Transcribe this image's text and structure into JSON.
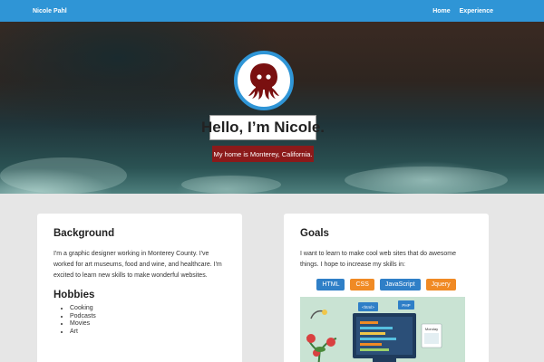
{
  "nav": {
    "brand": "Nicole Pahl",
    "links": [
      "Home",
      "Experience"
    ]
  },
  "hero": {
    "greeting": "Hello, I’m Nicole.",
    "subtitle": "My home is Monterey, California."
  },
  "background_card": {
    "title": "Background",
    "text": "I'm a graphic designer working in Monterey County. I've worked for art museums, food and wine, and healthcare. I'm excited to learn new skills to make wonderful websites.",
    "hobbies_title": "Hobbies",
    "hobbies": [
      "Cooking",
      "Podcasts",
      "Movies",
      "Art"
    ]
  },
  "goals_card": {
    "title": "Goals",
    "text": "I want to learn to make cool web sites that do awesome things. I hope to increase my skills in:",
    "skills": [
      "HTML",
      "CSS",
      "JavaScript",
      "Jquery"
    ],
    "illustration_labels": [
      "<html>",
      "PHP",
      "Monday"
    ]
  },
  "colors": {
    "nav": "#2f95d6",
    "subtitle_bg": "#8b1a1a",
    "blue_badge": "#2f7fc7",
    "orange_badge": "#f08a24"
  },
  "icons": [
    "octopus-icon"
  ]
}
